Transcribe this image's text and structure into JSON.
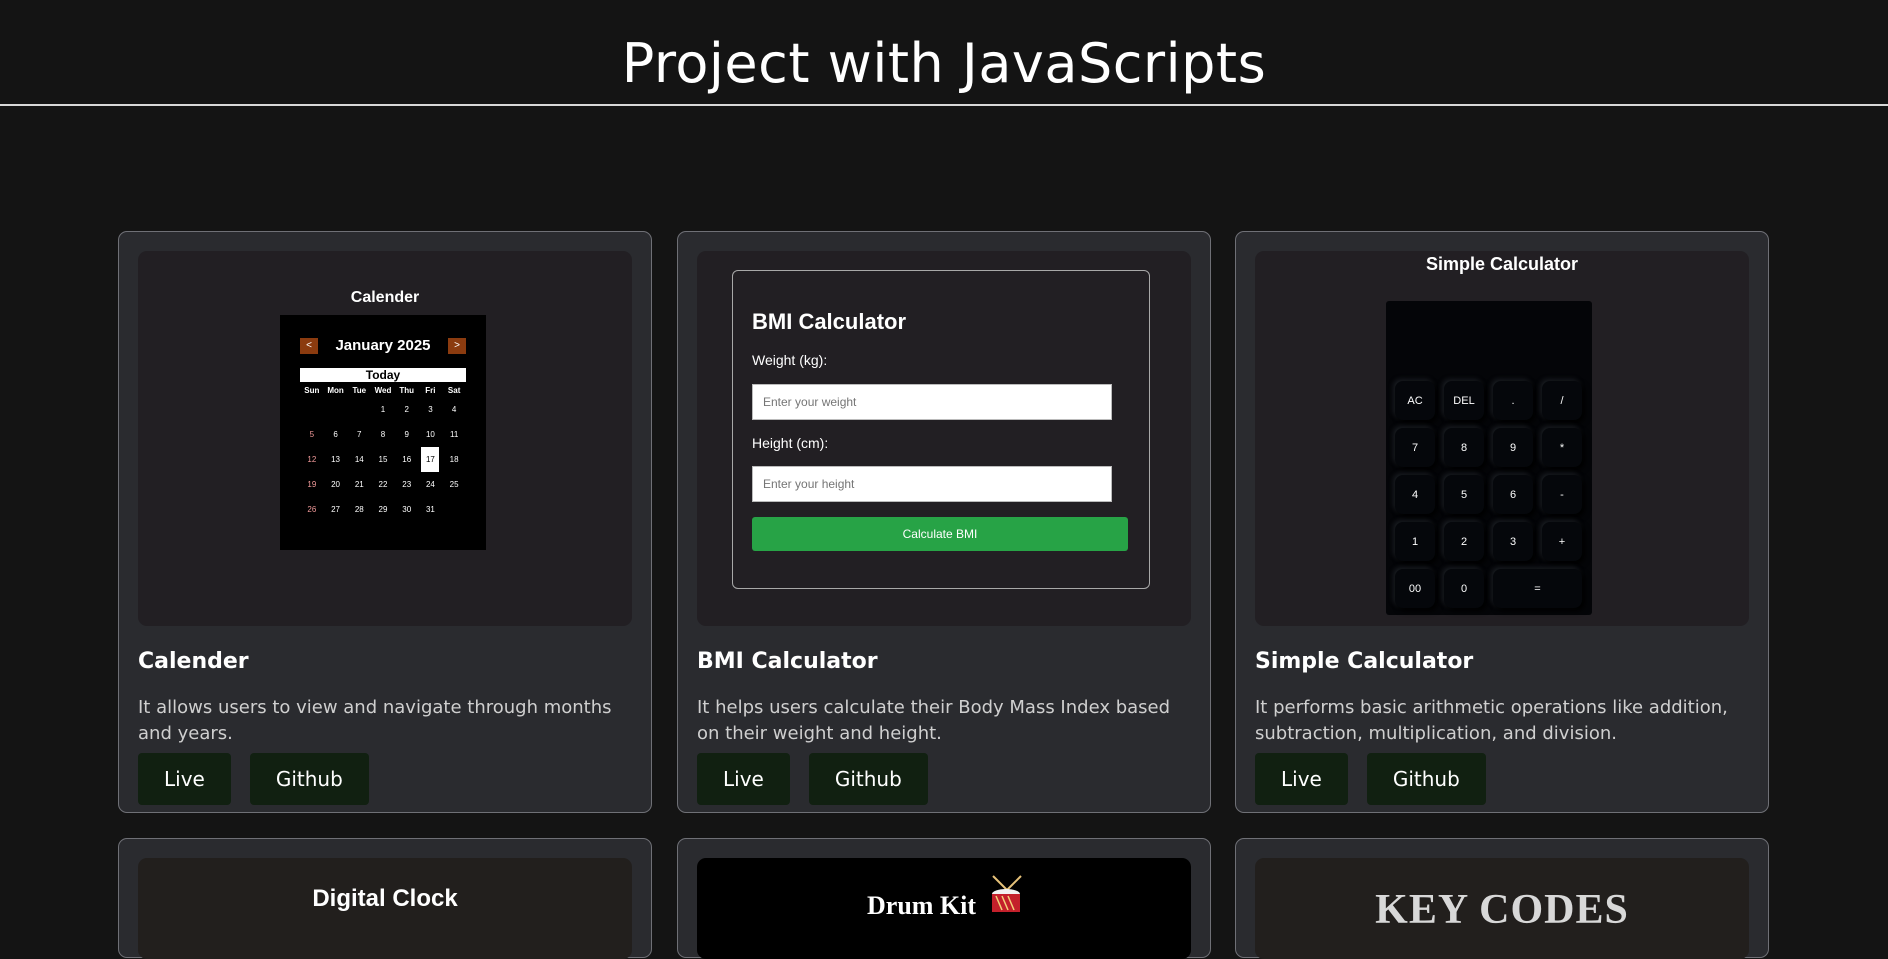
{
  "header": {
    "title": "Project with JavaScripts"
  },
  "projects": [
    {
      "preview_heading": "Calender",
      "title": "Calender",
      "description": "It allows users to view and navigate through months and years.",
      "live_label": "Live",
      "github_label": "Github"
    },
    {
      "preview_heading": "BMI Calculator",
      "title": "BMI Calculator",
      "description": "It helps users calculate their Body Mass Index based on their weight and height.",
      "live_label": "Live",
      "github_label": "Github"
    },
    {
      "preview_heading": "Simple Calculator",
      "title": "Simple Calculator",
      "description": "It performs basic arithmetic operations like addition, subtraction, multiplication, and division.",
      "live_label": "Live",
      "github_label": "Github"
    },
    {
      "preview_heading": "Digital Clock"
    },
    {
      "preview_heading": "Drum Kit"
    },
    {
      "preview_heading": "KEY CODES"
    }
  ],
  "calendar": {
    "prev": "<",
    "next": ">",
    "month": "January 2025",
    "today_label": "Today",
    "weekdays": [
      "Sun",
      "Mon",
      "Tue",
      "Wed",
      "Thu",
      "Fri",
      "Sat"
    ],
    "days": [
      "",
      "",
      "",
      "1",
      "2",
      "3",
      "4",
      "5",
      "6",
      "7",
      "8",
      "9",
      "10",
      "11",
      "12",
      "13",
      "14",
      "15",
      "16",
      "17",
      "18",
      "19",
      "20",
      "21",
      "22",
      "23",
      "24",
      "25",
      "26",
      "27",
      "28",
      "29",
      "30",
      "31"
    ],
    "selected_day": "17",
    "sunday_color": "#f29a9a"
  },
  "bmi": {
    "weight_label": "Weight (kg):",
    "weight_placeholder": "Enter your weight",
    "height_label": "Height (cm):",
    "height_placeholder": "Enter your height",
    "button_label": "Calculate BMI",
    "button_color": "#27a346"
  },
  "calculator": {
    "keys": [
      "AC",
      "DEL",
      ".",
      "/",
      "7",
      "8",
      "9",
      "*",
      "4",
      "5",
      "6",
      "-",
      "1",
      "2",
      "3",
      "+",
      "00",
      "0",
      "="
    ]
  },
  "colors": {
    "background": "#141414",
    "card": "#2a2b2f",
    "button": "#112011",
    "calendar_arrow": "#8b3b0f"
  }
}
